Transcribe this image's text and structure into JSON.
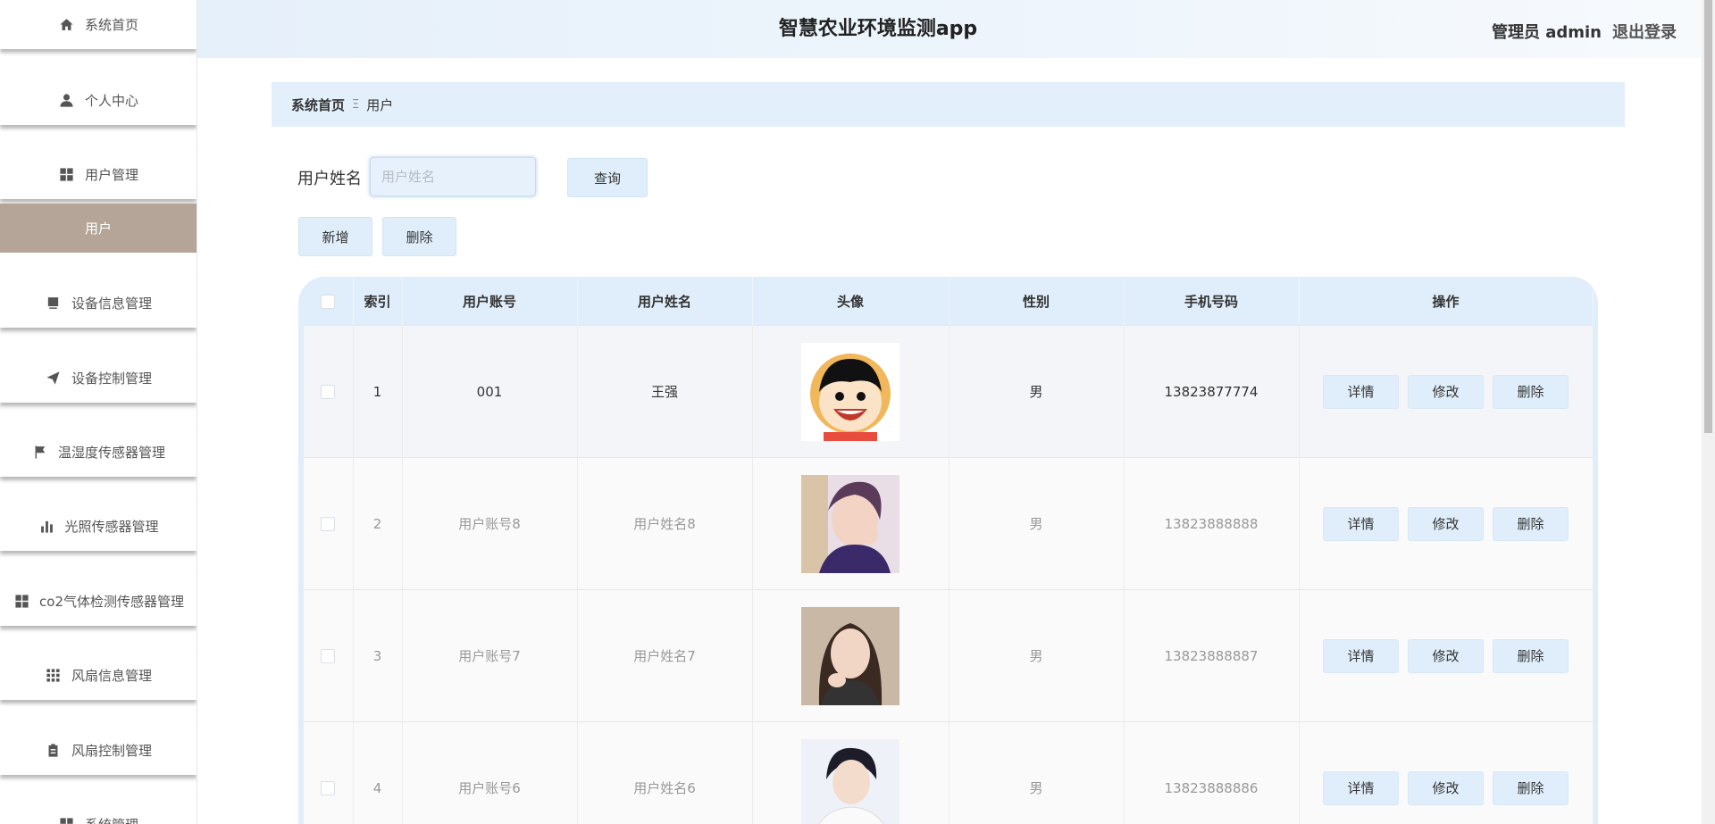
{
  "header": {
    "title": "智慧农业环境监测app",
    "user": "管理员 admin",
    "logout": "退出登录"
  },
  "sidebar": {
    "items": [
      {
        "label": "系统首页",
        "icon": "home-icon"
      },
      {
        "label": "个人中心",
        "icon": "user-icon"
      },
      {
        "label": "用户管理",
        "icon": "grid-icon"
      },
      {
        "label": "设备信息管理",
        "icon": "device-icon"
      },
      {
        "label": "设备控制管理",
        "icon": "send-icon"
      },
      {
        "label": "温湿度传感器管理",
        "icon": "flag-icon"
      },
      {
        "label": "光照传感器管理",
        "icon": "bar-chart-icon"
      },
      {
        "label": "co2气体检测传感器管理",
        "icon": "grid-icon"
      },
      {
        "label": "风扇信息管理",
        "icon": "apps-icon"
      },
      {
        "label": "风扇控制管理",
        "icon": "clipboard-icon"
      },
      {
        "label": "系统管理",
        "icon": "grid-icon"
      }
    ],
    "active_sub": "用户"
  },
  "breadcrumb": {
    "home": "系统首页",
    "separator": "Ξ",
    "current": "用户"
  },
  "search": {
    "label": "用户姓名",
    "placeholder": "用户姓名",
    "value": "",
    "query_button": "查询"
  },
  "actions": {
    "add": "新增",
    "delete": "删除"
  },
  "table": {
    "columns": [
      "",
      "索引",
      "用户账号",
      "用户姓名",
      "头像",
      "性别",
      "手机号码",
      "操作"
    ],
    "rows": [
      {
        "index": "1",
        "account": "001",
        "name": "王强",
        "avatar": "cartoon-avatar",
        "gender": "男",
        "phone": "13823877774"
      },
      {
        "index": "2",
        "account": "用户账号8",
        "name": "用户姓名8",
        "avatar": "photo-avatar",
        "gender": "男",
        "phone": "13823888888"
      },
      {
        "index": "3",
        "account": "用户账号7",
        "name": "用户姓名7",
        "avatar": "photo-avatar",
        "gender": "男",
        "phone": "13823888887"
      },
      {
        "index": "4",
        "account": "用户账号6",
        "name": "用户姓名6",
        "avatar": "photo-avatar",
        "gender": "男",
        "phone": "13823888886"
      }
    ],
    "row_actions": {
      "detail": "详情",
      "edit": "修改",
      "delete": "删除"
    }
  },
  "colors": {
    "accent": "#e0eefb",
    "active_sidebar": "#b5a598",
    "breadcrumb_bg": "#e3effb"
  }
}
